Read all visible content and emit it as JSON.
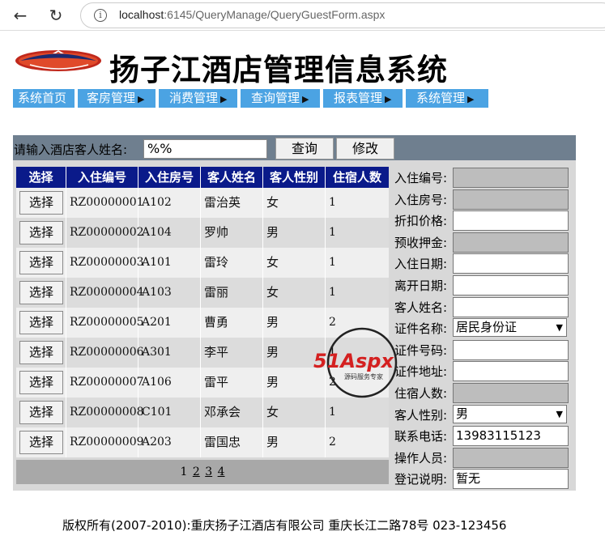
{
  "browser": {
    "url_host": "localhost",
    "url_rest": ":6145/QueryManage/QueryGuestForm.aspx"
  },
  "header": {
    "title": "扬子江酒店管理信息系统"
  },
  "menu": {
    "items": [
      {
        "label": "系统首页",
        "has_arrow": false
      },
      {
        "label": "客房管理",
        "has_arrow": true
      },
      {
        "label": "消费管理",
        "has_arrow": true
      },
      {
        "label": "查询管理",
        "has_arrow": true
      },
      {
        "label": "报表管理",
        "has_arrow": true
      },
      {
        "label": "系统管理",
        "has_arrow": true
      }
    ]
  },
  "search": {
    "label": "请输入酒店客人姓名:",
    "value": "%%",
    "query_label": "查询",
    "edit_label": "修改"
  },
  "grid": {
    "columns": [
      "选择",
      "入住编号",
      "入住房号",
      "客人姓名",
      "客人性别",
      "住宿人数"
    ],
    "select_label": "选择",
    "rows": [
      {
        "id": "RZ00000001",
        "room": "A102",
        "name": "雷治英",
        "gender": "女",
        "count": "1"
      },
      {
        "id": "RZ00000002",
        "room": "A104",
        "name": "罗帅",
        "gender": "男",
        "count": "1"
      },
      {
        "id": "RZ00000003",
        "room": "A101",
        "name": "雷玲",
        "gender": "女",
        "count": "1"
      },
      {
        "id": "RZ00000004",
        "room": "A103",
        "name": "雷丽",
        "gender": "女",
        "count": "1"
      },
      {
        "id": "RZ00000005",
        "room": "A201",
        "name": "曹勇",
        "gender": "男",
        "count": "2"
      },
      {
        "id": "RZ00000006",
        "room": "A301",
        "name": "李平",
        "gender": "男",
        "count": "1"
      },
      {
        "id": "RZ00000007",
        "room": "A106",
        "name": "雷平",
        "gender": "男",
        "count": "2"
      },
      {
        "id": "RZ00000008",
        "room": "C101",
        "name": "邓承会",
        "gender": "女",
        "count": "1"
      },
      {
        "id": "RZ00000009",
        "room": "A203",
        "name": "雷国忠",
        "gender": "男",
        "count": "2"
      }
    ],
    "pager": {
      "current": "1",
      "pages": [
        "2",
        "3",
        "4"
      ]
    }
  },
  "form": {
    "fields": [
      {
        "label": "入住编号:",
        "value": "",
        "readonly": true,
        "type": "text"
      },
      {
        "label": "入住房号:",
        "value": "",
        "readonly": true,
        "type": "text"
      },
      {
        "label": "折扣价格:",
        "value": "",
        "readonly": false,
        "type": "text"
      },
      {
        "label": "预收押金:",
        "value": "",
        "readonly": true,
        "type": "text"
      },
      {
        "label": "入住日期:",
        "value": "",
        "readonly": false,
        "type": "text"
      },
      {
        "label": "离开日期:",
        "value": "",
        "readonly": false,
        "type": "text"
      },
      {
        "label": "客人姓名:",
        "value": "",
        "readonly": false,
        "type": "text"
      },
      {
        "label": "证件名称:",
        "value": "居民身份证",
        "readonly": false,
        "type": "select"
      },
      {
        "label": "证件号码:",
        "value": "",
        "readonly": false,
        "type": "text"
      },
      {
        "label": "证件地址:",
        "value": "",
        "readonly": false,
        "type": "text"
      },
      {
        "label": "住宿人数:",
        "value": "",
        "readonly": true,
        "type": "text"
      },
      {
        "label": "客人性别:",
        "value": "男",
        "readonly": false,
        "type": "select"
      },
      {
        "label": "联系电话:",
        "value": "13983115123",
        "readonly": false,
        "type": "text"
      },
      {
        "label": "操作人员:",
        "value": "",
        "readonly": true,
        "type": "text"
      },
      {
        "label": "登记说明:",
        "value": "暂无",
        "readonly": false,
        "type": "text"
      }
    ]
  },
  "footer": {
    "text": "版权所有(2007-2010):重庆扬子江酒店有限公司 重庆长江二路78号 023-123456"
  },
  "watermark": {
    "brand": "51Aspx",
    "tagline": "源码服务专家"
  },
  "colors": {
    "menu_bg": "#4ba3e3",
    "grid_header_bg": "#0a1a8a",
    "search_bar_bg": "#6f7f8f",
    "watermark_red": "#d42020"
  }
}
